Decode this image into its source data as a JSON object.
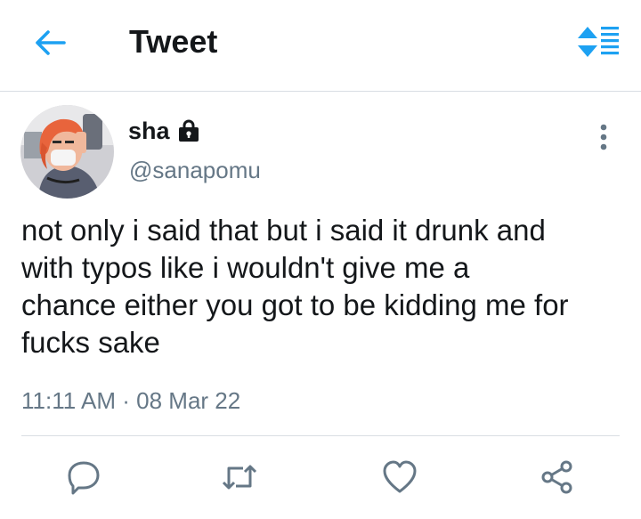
{
  "header": {
    "title": "Tweet",
    "back_icon": "arrow-left-icon",
    "sort_icon": "sort-list-icon"
  },
  "colors": {
    "accent": "#1da1f2",
    "text": "#14171a",
    "secondary_text": "#657786",
    "divider": "#d9dee3"
  },
  "tweet": {
    "display_name": "sha",
    "handle": "@sanapomu",
    "protected_icon": "lock-icon",
    "text": "not only i said that but i said it drunk and\nwith typos like i wouldn't give me a\nchance either you got to be kidding me for\nfucks sake",
    "time": "11:11 AM",
    "separator": "·",
    "date": "08 Mar 22"
  },
  "actions": [
    {
      "name": "reply-button",
      "icon": "reply-icon"
    },
    {
      "name": "retweet-button",
      "icon": "retweet-icon"
    },
    {
      "name": "like-button",
      "icon": "heart-icon"
    },
    {
      "name": "share-button",
      "icon": "share-icon"
    }
  ]
}
